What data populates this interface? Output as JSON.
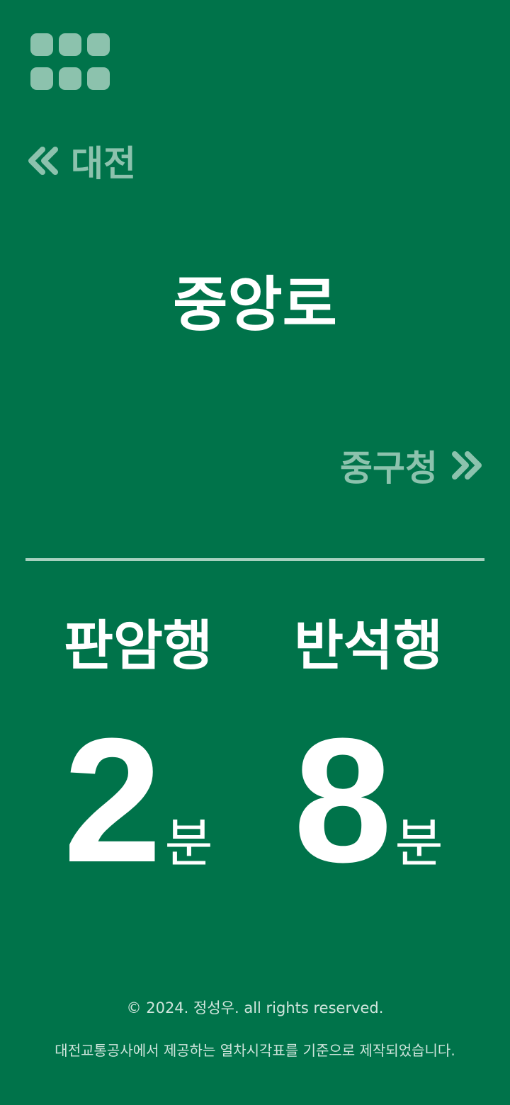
{
  "menu": {
    "icon": "grid-menu-icon"
  },
  "nav": {
    "prev": {
      "icon": "double-chevron-left-icon",
      "label": "대전"
    },
    "next": {
      "icon": "double-chevron-right-icon",
      "label": "중구청"
    }
  },
  "station": {
    "name": "중앙로"
  },
  "directions": [
    {
      "label": "판암행",
      "minutes": "2",
      "unit": "분"
    },
    {
      "label": "반석행",
      "minutes": "8",
      "unit": "분"
    }
  ],
  "footer": {
    "copyright": "© 2024. 정성우. all rights reserved.",
    "notice": "대전교통공사에서 제공하는 열차시각표를 기준으로 제작되었습니다."
  },
  "colors": {
    "background": "#00734a",
    "muted": "#8cc2ad",
    "text": "#ffffff"
  }
}
